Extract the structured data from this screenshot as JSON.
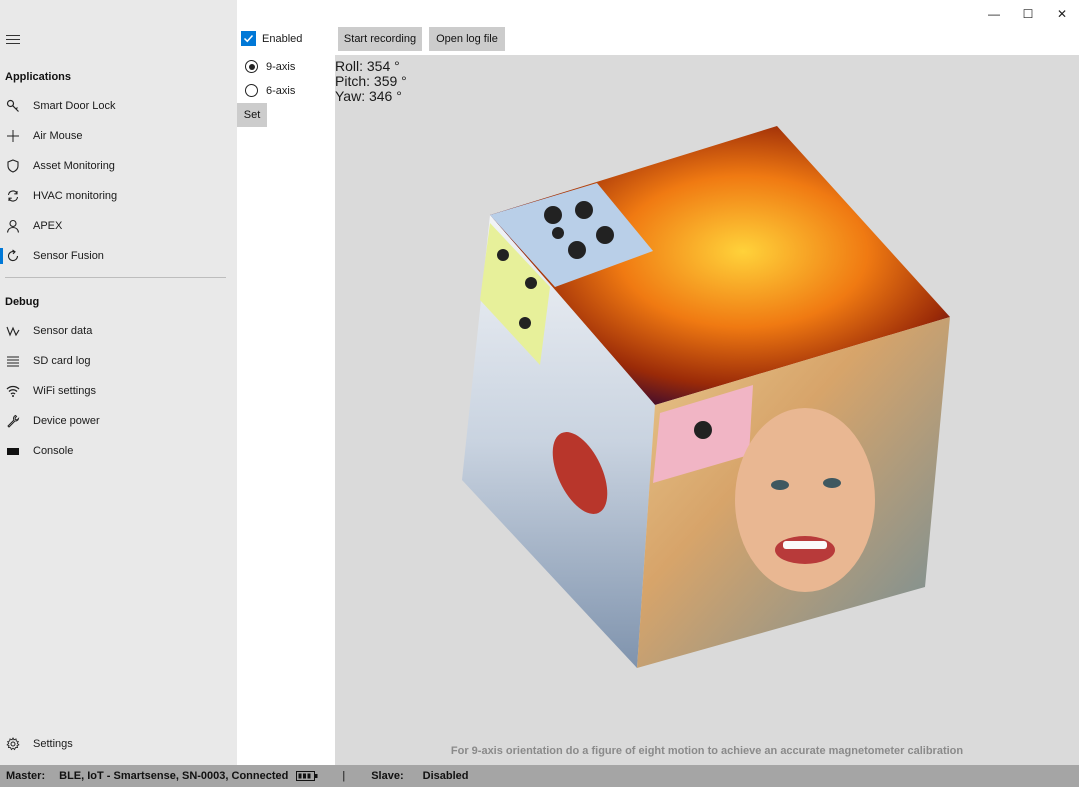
{
  "window": {
    "minimize_glyph": "—",
    "maximize_glyph": "☐",
    "close_glyph": "✕"
  },
  "sidebar": {
    "applications_title": "Applications",
    "applications": [
      {
        "label": "Smart Door Lock",
        "icon": "key-icon"
      },
      {
        "label": "Air Mouse",
        "icon": "plus-icon"
      },
      {
        "label": "Asset Monitoring",
        "icon": "shield-icon"
      },
      {
        "label": "HVAC monitoring",
        "icon": "sync-icon"
      },
      {
        "label": "APEX",
        "icon": "person-icon"
      },
      {
        "label": "Sensor Fusion",
        "icon": "refresh-icon"
      }
    ],
    "debug_title": "Debug",
    "debug": [
      {
        "label": "Sensor data",
        "icon": "signal-icon"
      },
      {
        "label": "SD card log",
        "icon": "list-icon"
      },
      {
        "label": "WiFi settings",
        "icon": "wifi-icon"
      },
      {
        "label": "Device power",
        "icon": "wrench-icon"
      },
      {
        "label": "Console",
        "icon": "console-icon"
      }
    ],
    "settings_label": "Settings"
  },
  "controls": {
    "enabled_label": "Enabled",
    "enabled_checked": true,
    "radio_9axis": "9-axis",
    "radio_6axis": "6-axis",
    "selected_mode": "9-axis",
    "set_label": "Set"
  },
  "toolbar": {
    "start_recording": "Start recording",
    "open_log_file": "Open log file"
  },
  "orientation": {
    "roll": "Roll: 354 °",
    "pitch": "Pitch: 359 °",
    "yaw": "Yaw: 346 °"
  },
  "calibration_hint": "For 9-axis orientation do a figure of eight motion to achieve an accurate magnetometer  calibration",
  "statusbar": {
    "master_label": "Master:",
    "master_value": "BLE, IoT - Smartsense, SN-0003, Connected",
    "separator": "|",
    "slave_label": "Slave:",
    "slave_value": "Disabled"
  },
  "colors": {
    "accent": "#0078d7",
    "sidebar_bg": "#e9e9e9",
    "viewport_bg": "#dadada",
    "statusbar_bg": "#a5a5a5"
  }
}
